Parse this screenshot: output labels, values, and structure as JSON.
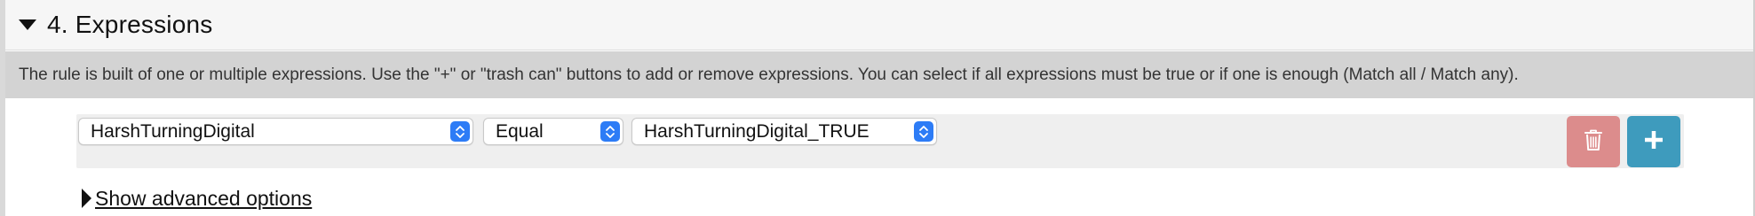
{
  "section": {
    "title": "4. Expressions",
    "info": "The rule is built of one or multiple expressions. Use the \"+\" or \"trash can\" buttons to add or remove expressions. You can select if all expressions must be true or if one is enough (Match all / Match any)."
  },
  "expression": {
    "field": "HarshTurningDigital",
    "operator": "Equal",
    "value": "HarshTurningDigital_TRUE"
  },
  "advanced": {
    "label": "Show advanced options"
  },
  "icons": {
    "section_toggle": "triangle-down-icon",
    "select_arrows": "updown-chevron-icon",
    "delete": "trash-icon",
    "add": "plus-icon",
    "advanced_toggle": "triangle-right-icon"
  },
  "colors": {
    "select_accent": "#2d7cf6",
    "delete_button": "#dc8c8c",
    "add_button": "#3e9bbd",
    "info_bar": "#d3d3d3"
  }
}
